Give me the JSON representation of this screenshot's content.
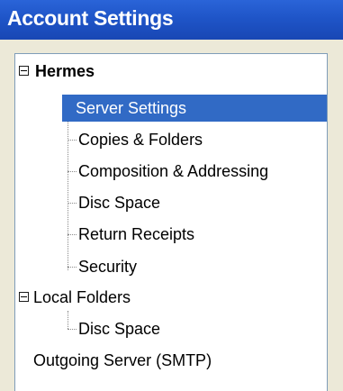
{
  "window": {
    "title": "Account Settings"
  },
  "tree": {
    "accounts": [
      {
        "label": "Hermes",
        "items": [
          {
            "label": "Server Settings",
            "selected": true
          },
          {
            "label": "Copies & Folders"
          },
          {
            "label": "Composition & Addressing"
          },
          {
            "label": "Disc Space"
          },
          {
            "label": "Return Receipts"
          },
          {
            "label": "Security"
          }
        ]
      },
      {
        "label": "Local Folders",
        "items": [
          {
            "label": "Disc Space"
          }
        ]
      }
    ],
    "outgoing_server": "Outgoing Server (SMTP)"
  },
  "colors": {
    "title_bar": "#1f55c8",
    "selection": "#316ac5"
  }
}
